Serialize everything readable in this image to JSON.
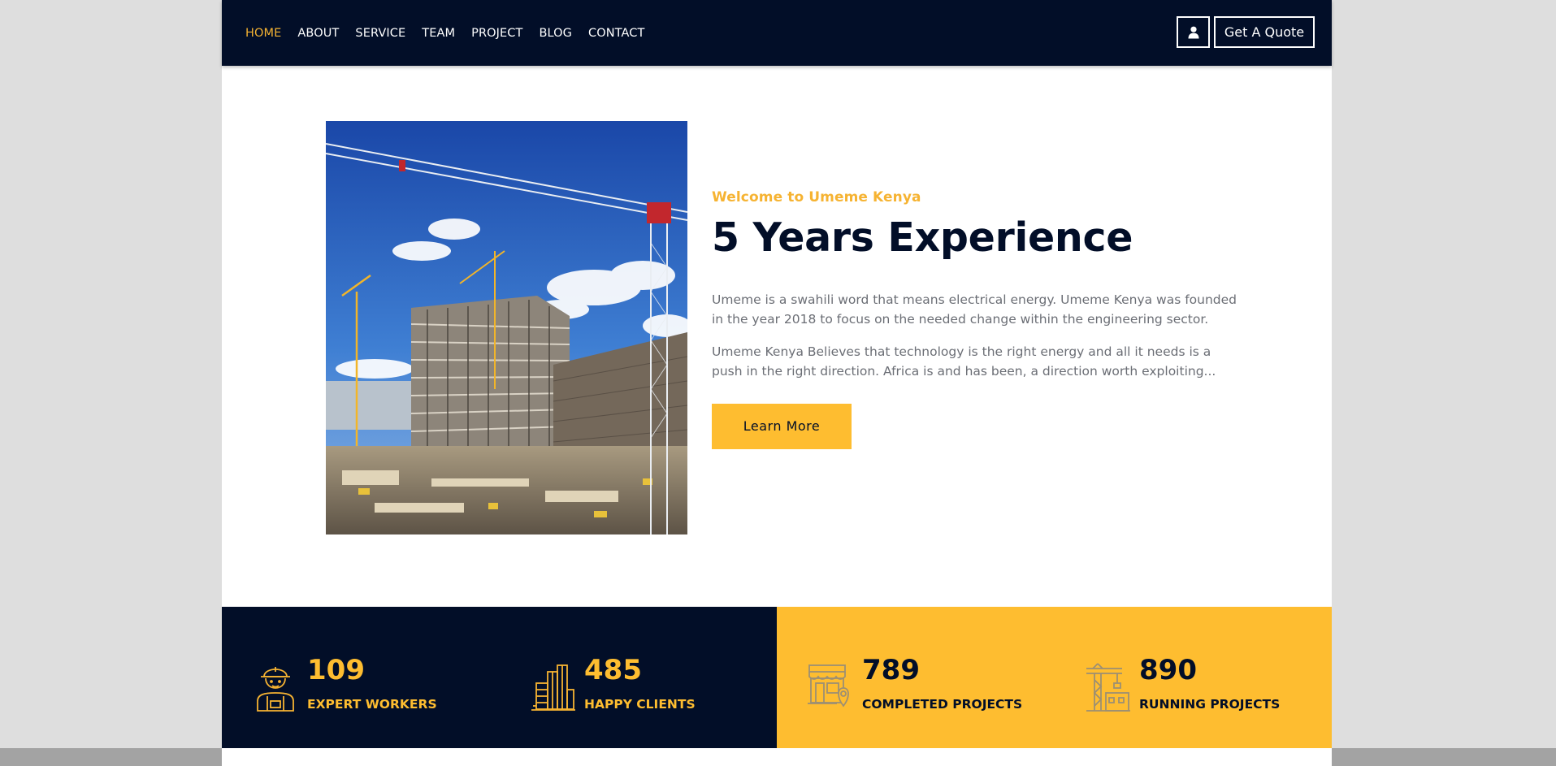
{
  "nav": {
    "items": [
      {
        "label": "HOME",
        "active": true
      },
      {
        "label": "ABOUT"
      },
      {
        "label": "SERVICE"
      },
      {
        "label": "TEAM"
      },
      {
        "label": "PROJECT"
      },
      {
        "label": "BLOG"
      },
      {
        "label": "CONTACT"
      }
    ],
    "user_icon": "user-icon",
    "quote_label": "Get A Quote"
  },
  "about": {
    "image": "construction-site-cranes-photo",
    "subtitle": "Welcome to Umeme Kenya",
    "title": "5 Years Experience",
    "paragraph1": "Umeme is a swahili word that means electrical energy. Umeme Kenya was founded in the year 2018 to focus on the needed change within the engineering sector.",
    "paragraph2": "Umeme Kenya Believes that technology is the right energy and all it needs is a push in the right direction. Africa is and has been, a direction worth exploiting...",
    "button_label": "Learn More"
  },
  "stats": [
    {
      "icon": "worker-icon",
      "value": "109",
      "label": "EXPERT WORKERS"
    },
    {
      "icon": "buildings-icon",
      "value": "485",
      "label": "HAPPY CLIENTS"
    },
    {
      "icon": "shop-location-icon",
      "value": "789",
      "label": "COMPLETED PROJECTS"
    },
    {
      "icon": "crane-construction-icon",
      "value": "890",
      "label": "RUNNING PROJECTS"
    }
  ],
  "colors": {
    "navy": "#020e28",
    "accent": "#febd30",
    "accent_text": "#f6b332",
    "body_text": "#6b6e75"
  }
}
